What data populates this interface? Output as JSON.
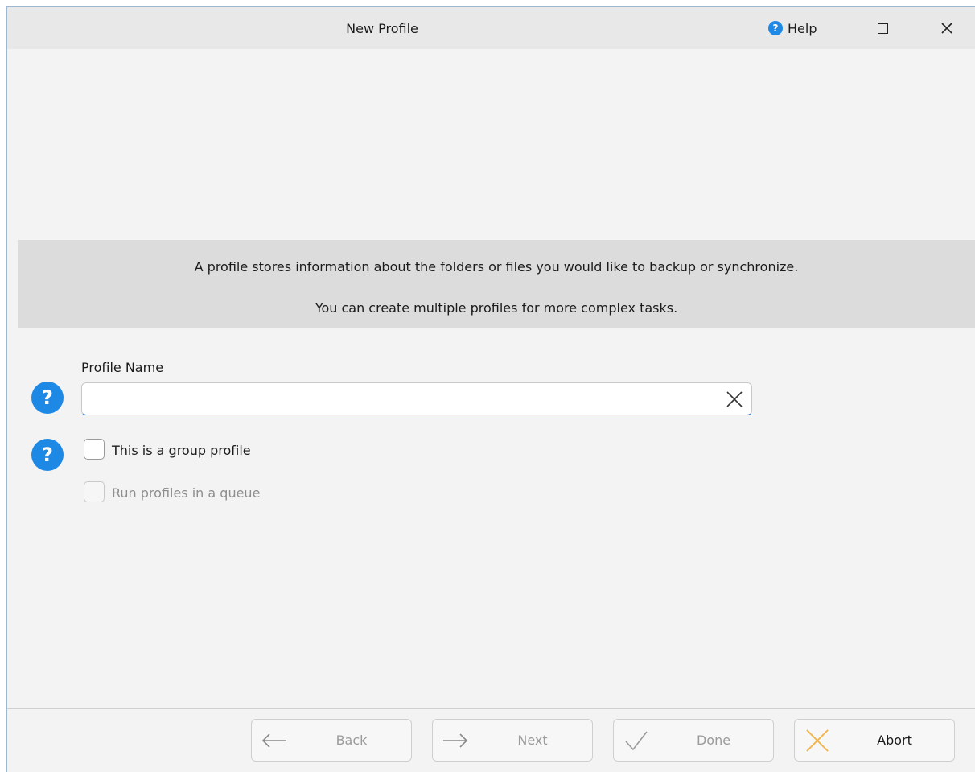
{
  "window": {
    "title": "New Profile",
    "help_label": "Help"
  },
  "info": {
    "line1": "A profile stores information about the folders or files you would like to backup or synchronize.",
    "line2": "You can create multiple profiles for more complex tasks."
  },
  "form": {
    "profile_name_label": "Profile Name",
    "profile_name_value": "",
    "group_profile_label": "This is a group profile",
    "group_profile_checked": false,
    "queue_label": "Run profiles in a queue",
    "queue_checked": false,
    "queue_enabled": false
  },
  "buttons": {
    "back": "Back",
    "next": "Next",
    "done": "Done",
    "abort": "Abort"
  },
  "icons": {
    "help": "help-icon",
    "maximize": "maximize-icon",
    "close": "close-icon",
    "clear": "clear-icon",
    "back": "arrow-left-icon",
    "next": "arrow-right-icon",
    "done": "checkmark-icon",
    "abort": "abort-x-icon"
  },
  "colors": {
    "accent": "#1e88e5",
    "abort_icon": "#f5b041"
  }
}
